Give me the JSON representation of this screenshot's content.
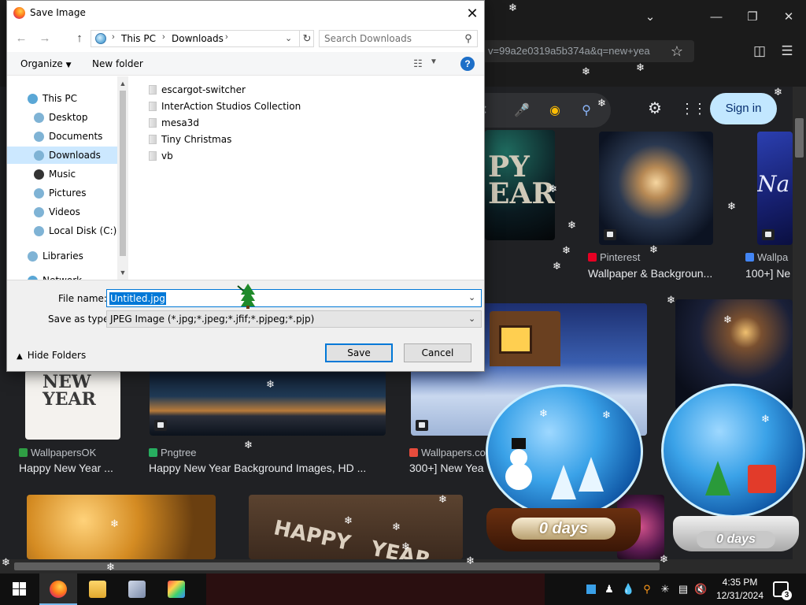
{
  "dialog": {
    "title": "Save Image",
    "breadcrumb": [
      "This PC",
      "Downloads"
    ],
    "search_placeholder": "Search Downloads",
    "toolbar": {
      "organize": "Organize",
      "new_folder": "New folder",
      "help": "?"
    },
    "nav_items": [
      {
        "label": "This PC",
        "icon": "pc-icon",
        "color": "#5aa7d6"
      },
      {
        "label": "Desktop",
        "icon": "desktop-icon",
        "color": "#7fb3d5"
      },
      {
        "label": "Documents",
        "icon": "documents-icon",
        "color": "#7fb3d5"
      },
      {
        "label": "Downloads",
        "icon": "downloads-icon",
        "color": "#7fb3d5",
        "selected": true
      },
      {
        "label": "Music",
        "icon": "music-icon",
        "color": "#333333"
      },
      {
        "label": "Pictures",
        "icon": "pictures-icon",
        "color": "#7fb3d5"
      },
      {
        "label": "Videos",
        "icon": "videos-icon",
        "color": "#7fb3d5"
      },
      {
        "label": "Local Disk (C:)",
        "icon": "disk-icon",
        "color": "#7fb3d5"
      },
      {
        "label": "Libraries",
        "icon": "libraries-icon",
        "color": "#7fb3d5"
      },
      {
        "label": "Network",
        "icon": "network-icon",
        "color": "#5aa7d6"
      }
    ],
    "files": [
      "escargot-switcher",
      "InterAction Studios Collection",
      "mesa3d",
      "Tiny Christmas",
      "vb"
    ],
    "file_name_label": "File name:",
    "file_name_value": "Untitled.jpg",
    "save_as_type_label": "Save as type:",
    "save_as_type_value": "JPEG Image (*.jpg;*.jpeg;*.jfif;*.pjpeg;*.pjp)",
    "hide_folders": "Hide Folders",
    "save": "Save",
    "cancel": "Cancel"
  },
  "browser": {
    "url_fragment": "v=99a2e0319a5b374a&q=new+yea",
    "sign_in": "Sign in",
    "results": [
      {
        "source": "Pinterest",
        "caption": "Wallpaper & Backgroun...",
        "fav_color": "#e60023"
      },
      {
        "source": "Wallpa",
        "caption": "100+] Ne",
        "fav_color": "#4285f4"
      },
      {
        "source": "WallpapersOK",
        "caption": "Happy New Year ...",
        "fav_color": "#2f9e44"
      },
      {
        "source": "Pngtree",
        "caption": "Happy New Year Background Images, HD ...",
        "fav_color": "#27ae60"
      },
      {
        "source": "Wallpapers.co",
        "caption": "300+] New Yea",
        "fav_color": "#e74c3c"
      }
    ],
    "thumb_texts": {
      "year": "PY\nEAR",
      "na": "Na",
      "new_year": "NEW\nYEAR",
      "happy": "HAPPY   YEAR"
    }
  },
  "globes": {
    "left_days": "0 days",
    "right_days": "0 days"
  },
  "taskbar": {
    "time": "4:35 PM",
    "date": "12/31/2024",
    "notification_count": "3"
  }
}
